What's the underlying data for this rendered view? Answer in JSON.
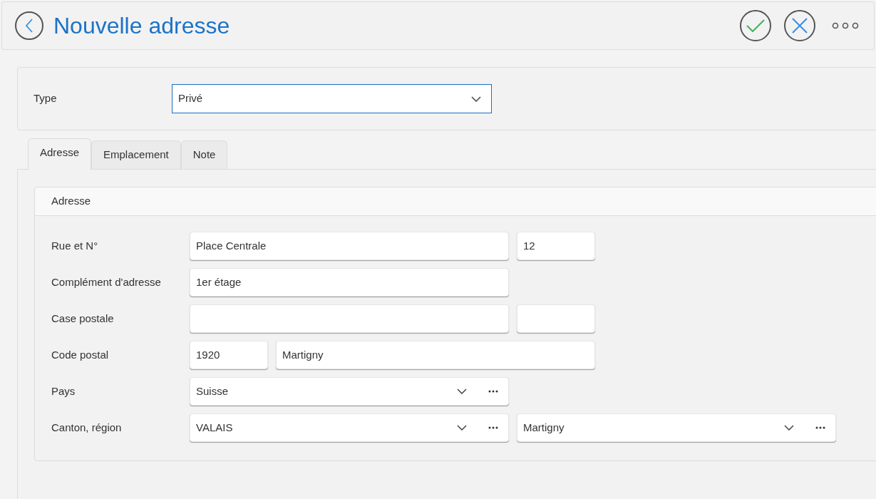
{
  "header": {
    "title": "Nouvelle adresse"
  },
  "type_field": {
    "label": "Type",
    "value": "Privé"
  },
  "tabs": [
    {
      "label": "Adresse",
      "selected": true
    },
    {
      "label": "Emplacement",
      "selected": false
    },
    {
      "label": "Note",
      "selected": false
    }
  ],
  "group": {
    "title": "Adresse",
    "rows": [
      {
        "label": "Rue et N°",
        "fields": [
          {
            "kind": "text",
            "value": "Place Centrale"
          },
          {
            "kind": "number",
            "value": "12"
          }
        ]
      },
      {
        "label": "Complément d'adresse",
        "fields": [
          {
            "kind": "text",
            "value": "1er étage"
          }
        ]
      },
      {
        "label": "Case postale",
        "fields": [
          {
            "kind": "text"
          },
          {
            "kind": "number"
          }
        ]
      },
      {
        "label": "Code postal",
        "fields": [
          {
            "kind": "number",
            "value": "1920"
          },
          {
            "kind": "text",
            "value": "Martigny"
          }
        ]
      },
      {
        "label": "Pays",
        "fields": [
          {
            "kind": "combo",
            "value": "Suisse"
          }
        ]
      },
      {
        "label": "Canton, région",
        "fields": [
          {
            "kind": "combo",
            "value": "VALAIS"
          },
          {
            "kind": "combo",
            "value": "Martigny"
          }
        ]
      }
    ]
  }
}
